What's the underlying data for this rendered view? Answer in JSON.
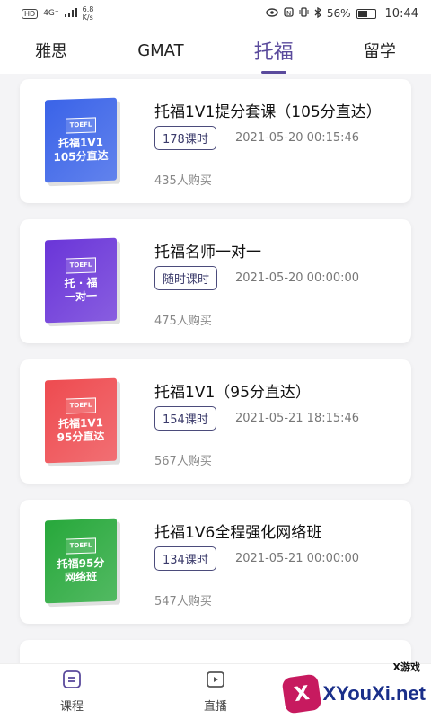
{
  "status": {
    "net_badge": "HD",
    "signal": "4G⁺",
    "speed": "6.8 K/s",
    "icons": [
      "eye-icon",
      "nfc-icon",
      "vibrate-icon",
      "bluetooth-icon"
    ],
    "battery": "56%",
    "time": "10:44"
  },
  "tabs": [
    {
      "label": "雅思"
    },
    {
      "label": "GMAT"
    },
    {
      "label": "托福"
    },
    {
      "label": "留学"
    }
  ],
  "courses": [
    {
      "title": "托福1V1提分套课（105分直达）",
      "hours": "178课时",
      "date": "2021-05-20 00:15:46",
      "buyers": "435人购买",
      "cover_tag": "TOEFL",
      "cover_line1": "托福1V1",
      "cover_line2": "105分直达",
      "cover_color": "#3a63e8"
    },
    {
      "title": "托福名师一对一",
      "hours": "随时课时",
      "date": "2021-05-20 00:00:00",
      "buyers": "475人购买",
      "cover_tag": "TOEFL",
      "cover_line1": "托 · 福",
      "cover_line2": "一对一",
      "cover_color": "#6a35d8"
    },
    {
      "title": "托福1V1（95分直达）",
      "hours": "154课时",
      "date": "2021-05-21 18:15:46",
      "buyers": "567人购买",
      "cover_tag": "TOEFL",
      "cover_line1": "托福1V1",
      "cover_line2": "95分直达",
      "cover_color": "#ee4b50"
    },
    {
      "title": "托福1V6全程强化网络班",
      "hours": "134课时",
      "date": "2021-05-21 00:00:00",
      "buyers": "547人购买",
      "cover_tag": "TOEFL",
      "cover_line1": "托福95分",
      "cover_line2": "网络班",
      "cover_color": "#27a83b"
    }
  ],
  "bottom_nav": [
    {
      "label": "课程",
      "icon": "course-icon"
    },
    {
      "label": "直播",
      "icon": "live-icon"
    }
  ],
  "watermark": {
    "brand": "XYouXi.net",
    "sub": "X游戏",
    "logo_letter": "X"
  }
}
